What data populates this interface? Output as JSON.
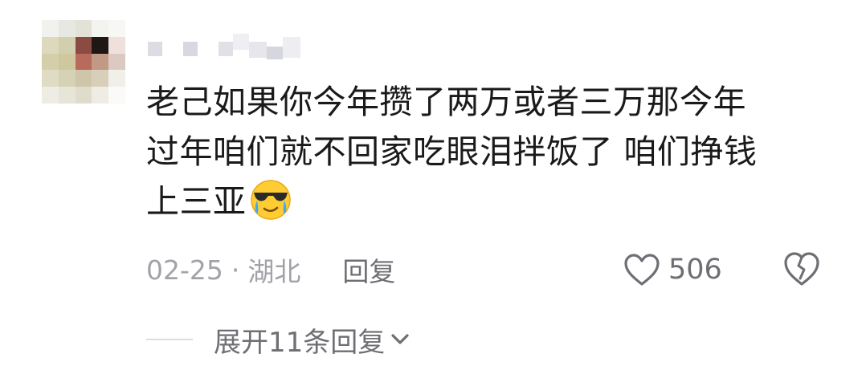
{
  "comment": {
    "content_lines": [
      "老己如果你今年攒了两万或者三万那今年",
      "过年咱们就不回家吃眼泪拌饭了 咱们挣钱",
      "上三亚"
    ],
    "emoji": "cool-crying-face-emoji",
    "date": "02-25",
    "separator": "·",
    "location": "湖北",
    "reply_label": "回复",
    "like_count": "506",
    "expand_label": "展开11条回复"
  },
  "colors": {
    "text_primary": "#1a1a1a",
    "text_meta": "#a2a2a8",
    "text_action": "#6e6e74",
    "emoji_face": "#ffcc33",
    "emoji_tear": "#3fa9f5"
  },
  "icons": {
    "like": "heart-outline-icon",
    "dislike": "broken-heart-icon",
    "expand": "chevron-down-icon"
  }
}
